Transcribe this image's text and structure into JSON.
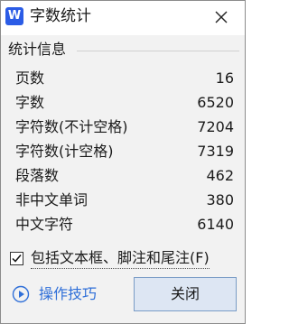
{
  "window": {
    "app_logo": "W",
    "title": "字数统计",
    "close_icon": "close-icon"
  },
  "section": {
    "label": "统计信息"
  },
  "stats": [
    {
      "label": "页数",
      "value": "16"
    },
    {
      "label": "字数",
      "value": "6520"
    },
    {
      "label": "字符数(不计空格)",
      "value": "7204"
    },
    {
      "label": "字符数(计空格)",
      "value": "7319"
    },
    {
      "label": "段落数",
      "value": "462"
    },
    {
      "label": "非中文单词",
      "value": "380"
    },
    {
      "label": "中文字符",
      "value": "6140"
    }
  ],
  "options": {
    "include_textboxes_label": "包括文本框、脚注和尾注(F)",
    "include_textboxes_checked": true
  },
  "footer": {
    "help_label": "操作技巧",
    "close_label": "关闭"
  },
  "colors": {
    "accent": "#2b5ce6",
    "link": "#2f6fd8",
    "button_bg": "#dde6f3",
    "button_border": "#7a9cc6"
  }
}
